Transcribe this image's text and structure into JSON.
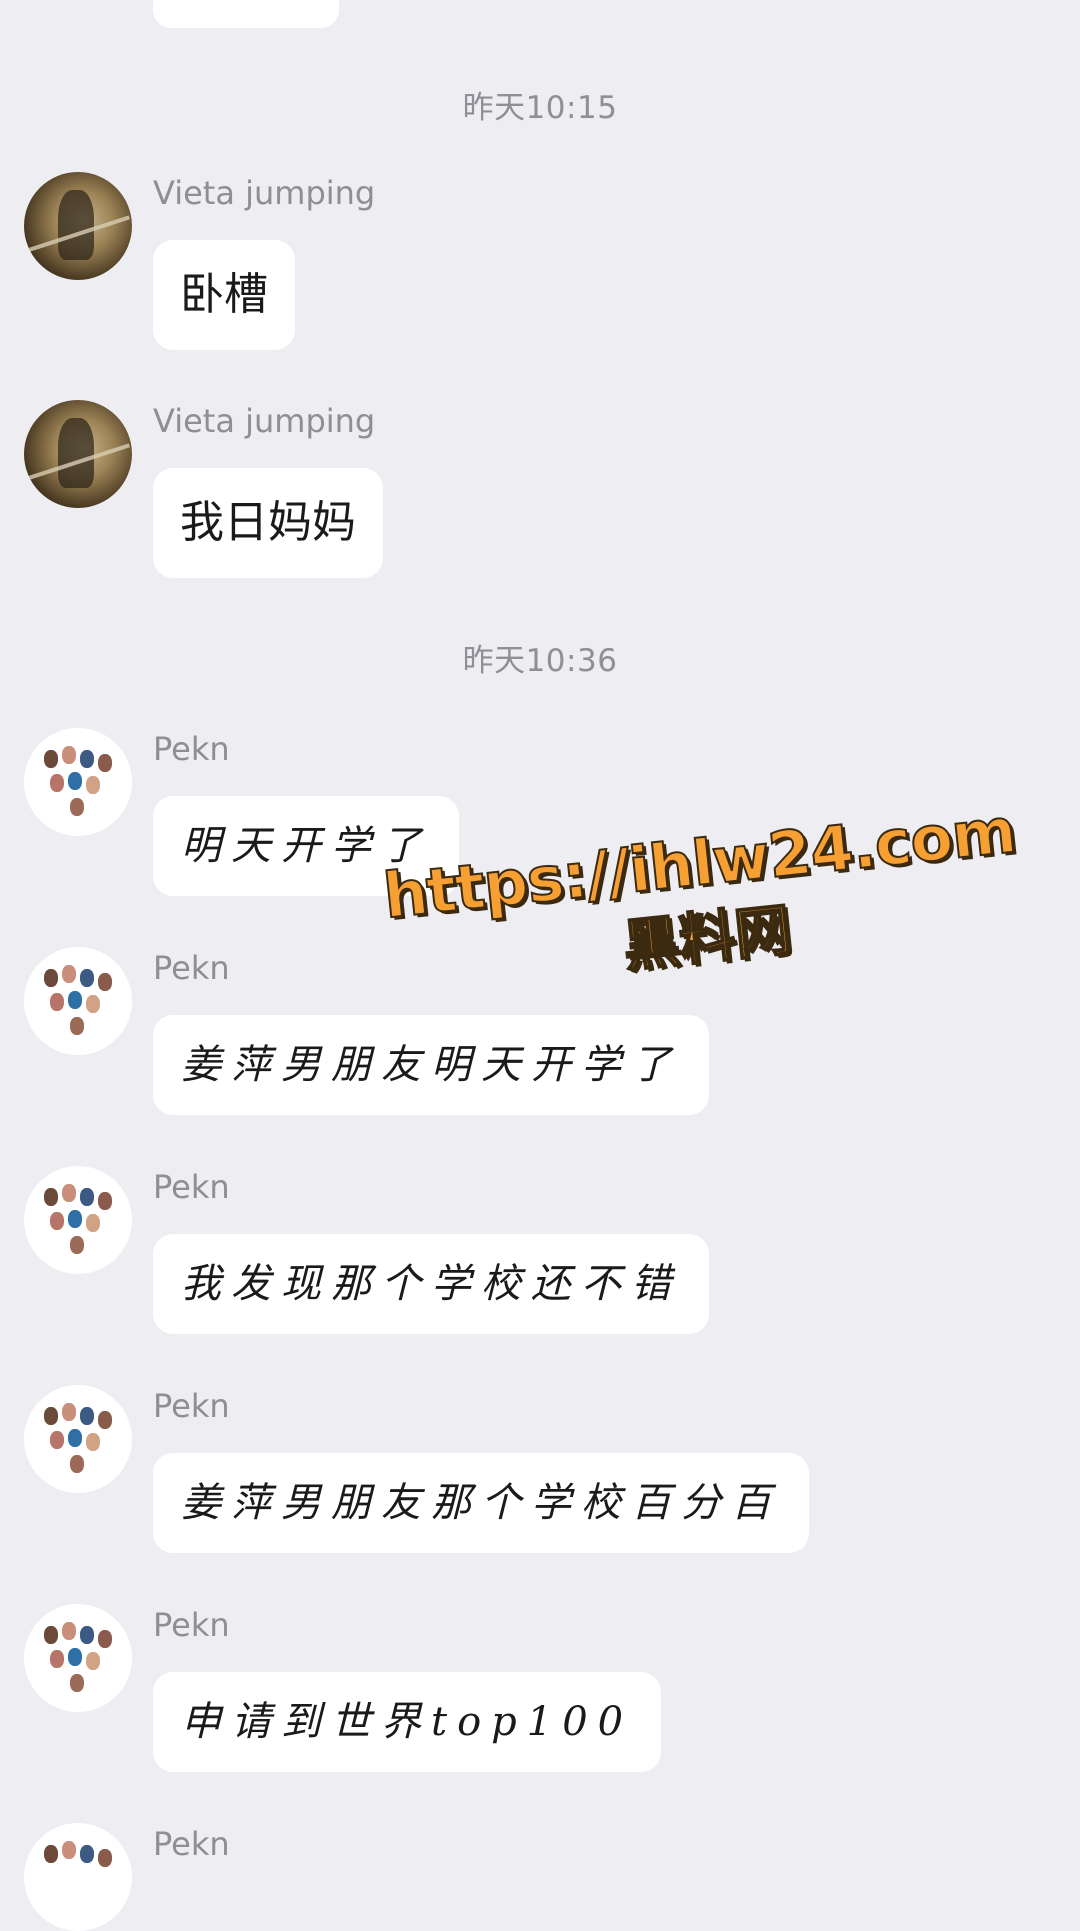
{
  "timestamps": [
    "昨天10:15",
    "昨天10:36"
  ],
  "messages": [
    {
      "sender": "Vieta jumping",
      "text": "卧槽"
    },
    {
      "sender": "Vieta jumping",
      "text": "我日妈妈"
    },
    {
      "sender": "Pekn",
      "text": "明天开学了"
    },
    {
      "sender": "Pekn",
      "text": "姜萍男朋友明天开学了"
    },
    {
      "sender": "Pekn",
      "text": "我发现那个学校还不错"
    },
    {
      "sender": "Pekn",
      "text": "姜萍男朋友那个学校百分百"
    },
    {
      "sender": "Pekn",
      "text": "申请到世界top100"
    },
    {
      "sender": "Pekn",
      "text": ""
    }
  ],
  "watermark": {
    "url": "https://ihlw24.com",
    "label": "黑料网"
  }
}
